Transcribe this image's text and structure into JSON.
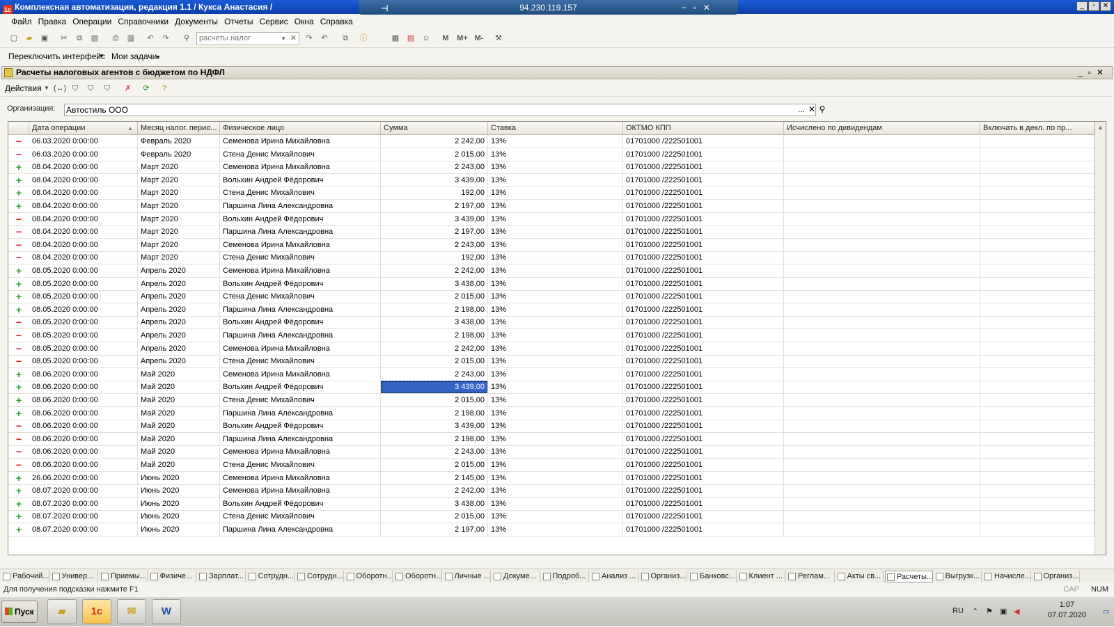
{
  "window": {
    "title": "Комплексная автоматизация, редакция 1.1 / Кукса Анастасия /",
    "rdp_address": "94.230.119.157"
  },
  "menu": [
    "Файл",
    "Правка",
    "Операции",
    "Справочники",
    "Документы",
    "Отчеты",
    "Сервис",
    "Окна",
    "Справка"
  ],
  "toolbar": {
    "search_value": "расчеты налог",
    "memory_buttons": [
      "M",
      "M+",
      "M-"
    ]
  },
  "toolbar2": {
    "switch_interface": "Переключить интерфейс",
    "my_tasks": "Мои задачи"
  },
  "form": {
    "title": "Расчеты налоговых агентов с бюджетом по НДФЛ",
    "actions_label": "Действия",
    "org_label": "Организация:",
    "org_value": "Автостиль ООО",
    "org_select": "..."
  },
  "table": {
    "columns": [
      "Дата операции",
      "Месяц налог. перио...",
      "Физическое лицо",
      "Сумма",
      "Ставка",
      "ОКТМО КПП",
      "Исчислено по дивидендам",
      "Включать в декл. по пр..."
    ],
    "rows": [
      {
        "sign": "−",
        "date": "06.03.2020 0:00:00",
        "month": "Февраль 2020",
        "person": "Семенова Ирина Михайловна",
        "sum": "2 242,00",
        "rate": "13%",
        "oktmo": "01701000   /222501001"
      },
      {
        "sign": "−",
        "date": "06.03.2020 0:00:00",
        "month": "Февраль 2020",
        "person": "Стена Денис Михайлович",
        "sum": "2 015,00",
        "rate": "13%",
        "oktmo": "01701000   /222501001"
      },
      {
        "sign": "+",
        "date": "08.04.2020 0:00:00",
        "month": "Март 2020",
        "person": "Семенова Ирина Михайловна",
        "sum": "2 243,00",
        "rate": "13%",
        "oktmo": "01701000   /222501001"
      },
      {
        "sign": "+",
        "date": "08.04.2020 0:00:00",
        "month": "Март 2020",
        "person": "Вольхин Андрей Фёдорович",
        "sum": "3 439,00",
        "rate": "13%",
        "oktmo": "01701000   /222501001"
      },
      {
        "sign": "+",
        "date": "08.04.2020 0:00:00",
        "month": "Март 2020",
        "person": "Стена Денис Михайлович",
        "sum": "192,00",
        "rate": "13%",
        "oktmo": "01701000   /222501001"
      },
      {
        "sign": "+",
        "date": "08.04.2020 0:00:00",
        "month": "Март 2020",
        "person": "Паршина Лина Александровна",
        "sum": "2 197,00",
        "rate": "13%",
        "oktmo": "01701000   /222501001"
      },
      {
        "sign": "−",
        "date": "08.04.2020 0:00:00",
        "month": "Март 2020",
        "person": "Вольхин Андрей Фёдорович",
        "sum": "3 439,00",
        "rate": "13%",
        "oktmo": "01701000   /222501001"
      },
      {
        "sign": "−",
        "date": "08.04.2020 0:00:00",
        "month": "Март 2020",
        "person": "Паршина Лина Александровна",
        "sum": "2 197,00",
        "rate": "13%",
        "oktmo": "01701000   /222501001"
      },
      {
        "sign": "−",
        "date": "08.04.2020 0:00:00",
        "month": "Март 2020",
        "person": "Семенова Ирина Михайловна",
        "sum": "2 243,00",
        "rate": "13%",
        "oktmo": "01701000   /222501001"
      },
      {
        "sign": "−",
        "date": "08.04.2020 0:00:00",
        "month": "Март 2020",
        "person": "Стена Денис Михайлович",
        "sum": "192,00",
        "rate": "13%",
        "oktmo": "01701000   /222501001"
      },
      {
        "sign": "+",
        "date": "08.05.2020 0:00:00",
        "month": "Апрель 2020",
        "person": "Семенова Ирина Михайловна",
        "sum": "2 242,00",
        "rate": "13%",
        "oktmo": "01701000   /222501001"
      },
      {
        "sign": "+",
        "date": "08.05.2020 0:00:00",
        "month": "Апрель 2020",
        "person": "Вольхин Андрей Фёдорович",
        "sum": "3 438,00",
        "rate": "13%",
        "oktmo": "01701000   /222501001"
      },
      {
        "sign": "+",
        "date": "08.05.2020 0:00:00",
        "month": "Апрель 2020",
        "person": "Стена Денис Михайлович",
        "sum": "2 015,00",
        "rate": "13%",
        "oktmo": "01701000   /222501001"
      },
      {
        "sign": "+",
        "date": "08.05.2020 0:00:00",
        "month": "Апрель 2020",
        "person": "Паршина Лина Александровна",
        "sum": "2 198,00",
        "rate": "13%",
        "oktmo": "01701000   /222501001"
      },
      {
        "sign": "−",
        "date": "08.05.2020 0:00:00",
        "month": "Апрель 2020",
        "person": "Вольхин Андрей Фёдорович",
        "sum": "3 438,00",
        "rate": "13%",
        "oktmo": "01701000   /222501001"
      },
      {
        "sign": "−",
        "date": "08.05.2020 0:00:00",
        "month": "Апрель 2020",
        "person": "Паршина Лина Александровна",
        "sum": "2 198,00",
        "rate": "13%",
        "oktmo": "01701000   /222501001"
      },
      {
        "sign": "−",
        "date": "08.05.2020 0:00:00",
        "month": "Апрель 2020",
        "person": "Семенова Ирина Михайловна",
        "sum": "2 242,00",
        "rate": "13%",
        "oktmo": "01701000   /222501001"
      },
      {
        "sign": "−",
        "date": "08.05.2020 0:00:00",
        "month": "Апрель 2020",
        "person": "Стена Денис Михайлович",
        "sum": "2 015,00",
        "rate": "13%",
        "oktmo": "01701000   /222501001"
      },
      {
        "sign": "+",
        "date": "08.06.2020 0:00:00",
        "month": "Май 2020",
        "person": "Семенова Ирина Михайловна",
        "sum": "2 243,00",
        "rate": "13%",
        "oktmo": "01701000   /222501001"
      },
      {
        "sign": "+",
        "date": "08.06.2020 0:00:00",
        "month": "Май 2020",
        "person": "Вольхин Андрей Фёдорович",
        "sum": "3 439,00",
        "rate": "13%",
        "oktmo": "01701000   /222501001",
        "selected": true
      },
      {
        "sign": "+",
        "date": "08.06.2020 0:00:00",
        "month": "Май 2020",
        "person": "Стена Денис Михайлович",
        "sum": "2 015,00",
        "rate": "13%",
        "oktmo": "01701000   /222501001"
      },
      {
        "sign": "+",
        "date": "08.06.2020 0:00:00",
        "month": "Май 2020",
        "person": "Паршина Лина Александровна",
        "sum": "2 198,00",
        "rate": "13%",
        "oktmo": "01701000   /222501001"
      },
      {
        "sign": "−",
        "date": "08.06.2020 0:00:00",
        "month": "Май 2020",
        "person": "Вольхин Андрей Фёдорович",
        "sum": "3 439,00",
        "rate": "13%",
        "oktmo": "01701000   /222501001"
      },
      {
        "sign": "−",
        "date": "08.06.2020 0:00:00",
        "month": "Май 2020",
        "person": "Паршина Лина Александровна",
        "sum": "2 198,00",
        "rate": "13%",
        "oktmo": "01701000   /222501001"
      },
      {
        "sign": "−",
        "date": "08.06.2020 0:00:00",
        "month": "Май 2020",
        "person": "Семенова Ирина Михайловна",
        "sum": "2 243,00",
        "rate": "13%",
        "oktmo": "01701000   /222501001"
      },
      {
        "sign": "−",
        "date": "08.06.2020 0:00:00",
        "month": "Май 2020",
        "person": "Стена Денис Михайлович",
        "sum": "2 015,00",
        "rate": "13%",
        "oktmo": "01701000   /222501001"
      },
      {
        "sign": "+",
        "date": "26.06.2020 0:00:00",
        "month": "Июнь 2020",
        "person": "Семенова Ирина Михайловна",
        "sum": "2 145,00",
        "rate": "13%",
        "oktmo": "01701000   /222501001"
      },
      {
        "sign": "+",
        "date": "08.07.2020 0:00:00",
        "month": "Июнь 2020",
        "person": "Семенова Ирина Михайловна",
        "sum": "2 242,00",
        "rate": "13%",
        "oktmo": "01701000   /222501001"
      },
      {
        "sign": "+",
        "date": "08.07.2020 0:00:00",
        "month": "Июнь 2020",
        "person": "Вольхин Андрей Фёдорович",
        "sum": "3 438,00",
        "rate": "13%",
        "oktmo": "01701000   /222501001"
      },
      {
        "sign": "+",
        "date": "08.07.2020 0:00:00",
        "month": "Июнь 2020",
        "person": "Стена Денис Михайлович",
        "sum": "2 015,00",
        "rate": "13%",
        "oktmo": "01701000   /222501001"
      },
      {
        "sign": "+",
        "date": "08.07.2020 0:00:00",
        "month": "Июнь 2020",
        "person": "Паршина Лина Александровна",
        "sum": "2 197,00",
        "rate": "13%",
        "oktmo": "01701000   /222501001"
      }
    ]
  },
  "window_tabs": [
    "Рабочий...",
    "Универ...",
    "Приемы...",
    "Физиче...",
    "Зарплат...",
    "Сотрудн...",
    "Сотрудн...",
    "Оборотн...",
    "Оборотн...",
    "Личные ...",
    "Докуме...",
    "Подроб...",
    "Анализ ...",
    "Организ...",
    "Банковс...",
    "Клиент ...",
    "Реглам...",
    "Акты св...",
    "Расчеты...",
    "Выгрузк...",
    "Начисле...",
    "Организ..."
  ],
  "status": {
    "hint": "Для получения подсказки нажмите F1",
    "cap": "CAP",
    "num": "NUM"
  },
  "taskbar": {
    "start": "Пуск",
    "lang": "RU",
    "time": "1:07",
    "date": "07.07.2020"
  },
  "colors": {
    "selection": "#3563c7",
    "plus": "#2aa02a",
    "minus": "#d12121"
  }
}
